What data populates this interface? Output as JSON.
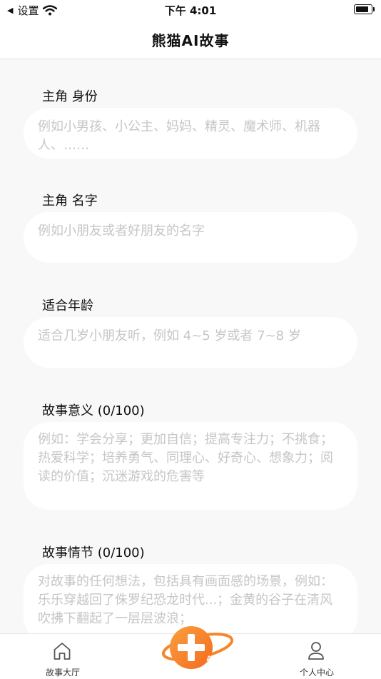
{
  "status_bar": {
    "back_label": "设置",
    "time": "下午 4:01"
  },
  "nav": {
    "title": "熊猫AI故事"
  },
  "form": {
    "fields": [
      {
        "label": "主角 身份",
        "placeholder": "例如小男孩、小公主、妈妈、精灵、魔术师、机器人、……"
      },
      {
        "label": "主角 名字",
        "placeholder": "例如小朋友或者好朋友的名字"
      },
      {
        "label": "适合年龄",
        "placeholder": "适合几岁小朋友听，例如 4~5 岁或者 7~8 岁"
      },
      {
        "label": "故事意义 (0/100)",
        "placeholder": "例如：学会分享；更加自信；提高专注力；不挑食；热爱科学；培养勇气、同理心、好奇心、想象力；阅读的价值；沉迷游戏的危害等"
      },
      {
        "label": "故事情节 (0/100)",
        "placeholder": "对故事的任何想法，包括具有画面感的场景，例如：乐乐穿越回了侏罗纪恐龙时代...；金黄的谷子在清风吹拂下翻起了一层层波浪；"
      }
    ]
  },
  "tabbar": {
    "left_label": "故事大厅",
    "right_label": "个人中心",
    "center_badge": "AI"
  },
  "colors": {
    "accent_orange": "#f7862b",
    "placeholder": "#c6c6c6",
    "background": "#f8f8f8"
  }
}
